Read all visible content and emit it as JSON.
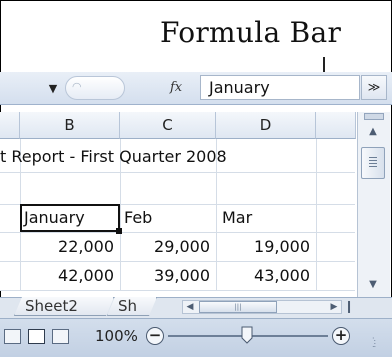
{
  "callout": {
    "title": "Formula Bar"
  },
  "formula_bar": {
    "fx_label": "fx",
    "value": "January",
    "expand_glyph": "≫"
  },
  "columns": [
    "B",
    "C",
    "D"
  ],
  "rows": {
    "title": "t Report - First Quarter 2008",
    "headers": [
      "January",
      "Feb",
      "Mar"
    ],
    "row1": [
      "22,000",
      "29,000",
      "19,000"
    ],
    "row2": [
      "42,000",
      "39,000",
      "43,000"
    ]
  },
  "sheet_tabs": [
    "Sheet2",
    "Sh"
  ],
  "status": {
    "zoom": "100%",
    "zoom_out": "−",
    "zoom_in": "+"
  },
  "icons": {
    "name_box_dropdown": "triangle-down-icon",
    "insert_function": "fx-icon",
    "expand_formula": "double-chevron-down-icon"
  },
  "colors": {
    "active_border": "#111111",
    "chrome_blue": "#d4dfee"
  }
}
